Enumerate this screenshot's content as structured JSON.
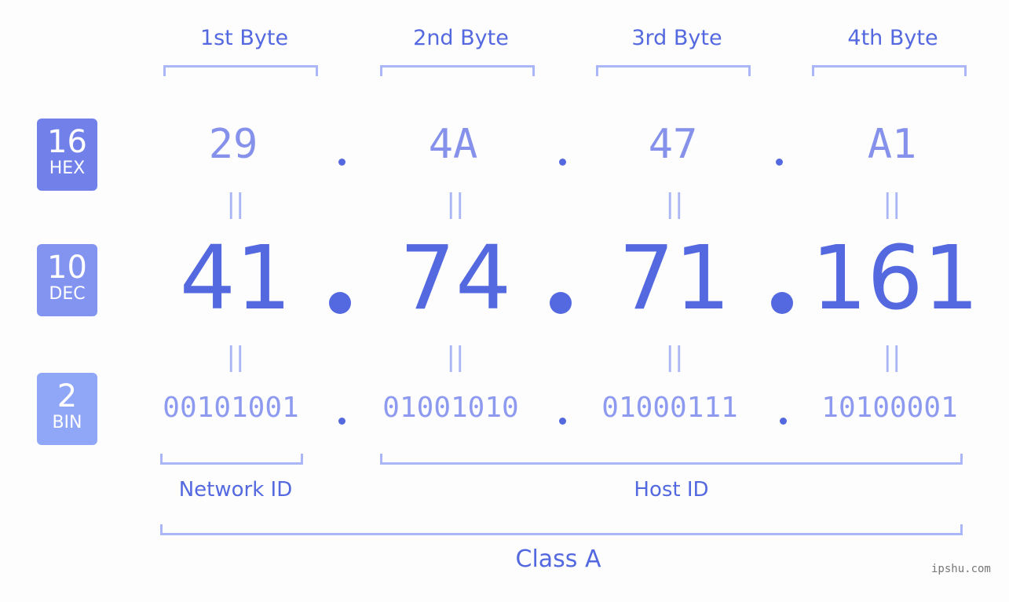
{
  "headers": [
    "1st Byte",
    "2nd Byte",
    "3rd Byte",
    "4th Byte"
  ],
  "badges": [
    {
      "num": "16",
      "label": "HEX",
      "color": "#7280ea"
    },
    {
      "num": "10",
      "label": "DEC",
      "color": "#8393f0"
    },
    {
      "num": "2",
      "label": "BIN",
      "color": "#90a7f8"
    }
  ],
  "hex": [
    "29",
    "4A",
    "47",
    "A1"
  ],
  "dec": [
    "41",
    "74",
    "71",
    "161"
  ],
  "bin": [
    "00101001",
    "01001010",
    "01000111",
    "10100001"
  ],
  "equals_symbol": "||",
  "network_label": "Network ID",
  "host_label": "Host ID",
  "class_label": "Class A",
  "watermark": "ipshu.com"
}
